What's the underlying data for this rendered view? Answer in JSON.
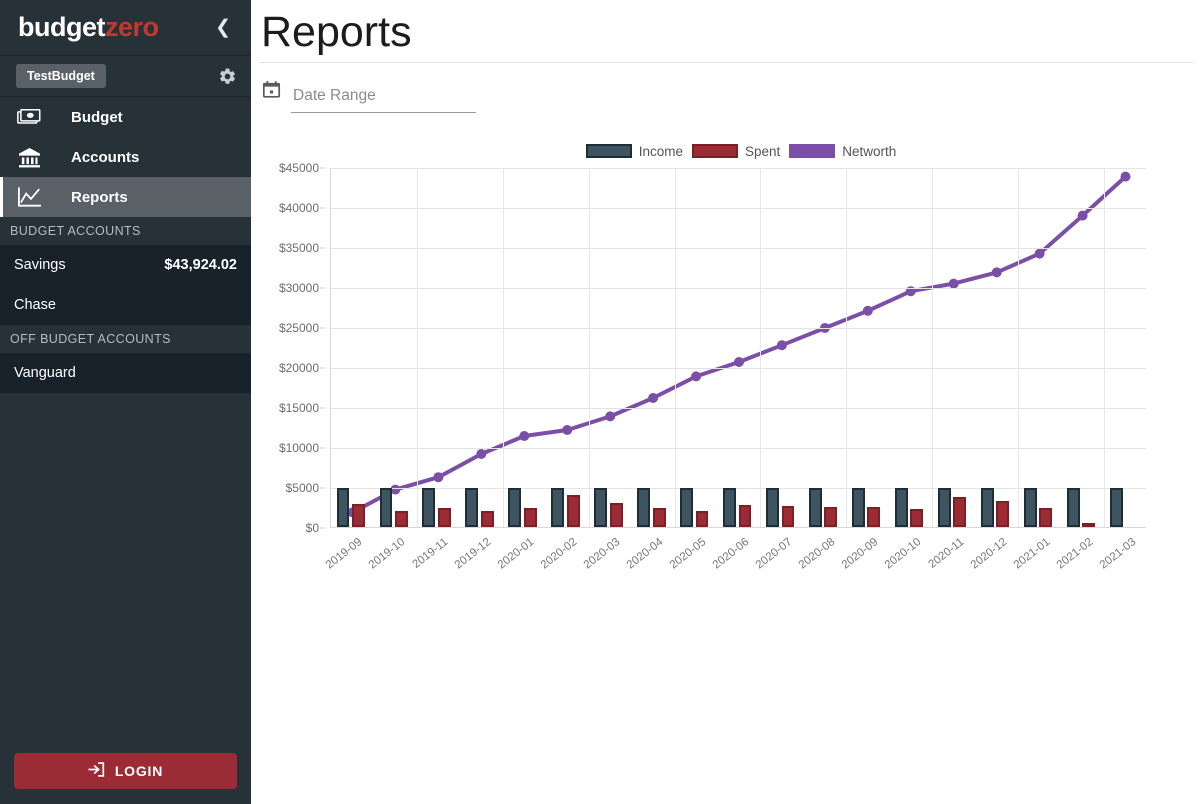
{
  "sidebar": {
    "brand": {
      "part1": "budget",
      "part2": "zero"
    },
    "collapse_icon": "chevron-left-icon",
    "budget_chip": "TestBudget",
    "settings_icon": "gear-icon",
    "nav": [
      {
        "label": "Budget",
        "icon": "money-icon",
        "active": false
      },
      {
        "label": "Accounts",
        "icon": "bank-icon",
        "active": false
      },
      {
        "label": "Reports",
        "icon": "chart-line-icon",
        "active": true
      }
    ],
    "budget_accounts_header": "BUDGET ACCOUNTS",
    "budget_accounts": [
      {
        "name": "Savings",
        "balance": "$43,924.02"
      },
      {
        "name": "Chase",
        "balance": ""
      }
    ],
    "off_budget_accounts_header": "OFF BUDGET ACCOUNTS",
    "off_budget_accounts": [
      {
        "name": "Vanguard",
        "balance": ""
      }
    ],
    "login_label": "LOGIN",
    "login_icon": "login-arrow-icon",
    "login_color": "#9b2c35"
  },
  "main": {
    "page_title": "Reports",
    "date_range": {
      "icon": "calendar-icon",
      "placeholder": "Date Range",
      "value": ""
    }
  },
  "chart_data": {
    "type": "bar",
    "title": "",
    "xlabel": "",
    "ylabel": "",
    "ylim": [
      0,
      45000
    ],
    "yticks": [
      0,
      5000,
      10000,
      15000,
      20000,
      25000,
      30000,
      35000,
      40000,
      45000
    ],
    "ytick_labels": [
      "$0",
      "$5000",
      "$10000",
      "$15000",
      "$20000",
      "$25000",
      "$30000",
      "$35000",
      "$40000",
      "$45000"
    ],
    "grid": true,
    "legend_position": "top-center",
    "categories": [
      "2019-09",
      "2019-10",
      "2019-11",
      "2019-12",
      "2020-01",
      "2020-02",
      "2020-03",
      "2020-04",
      "2020-05",
      "2020-06",
      "2020-07",
      "2020-08",
      "2020-09",
      "2020-10",
      "2020-11",
      "2020-12",
      "2021-01",
      "2021-02",
      "2021-03"
    ],
    "series": [
      {
        "name": "Income",
        "type": "bar",
        "color": "#3f5461",
        "border_color": "#1e2e36",
        "values": [
          4920,
          4920,
          4920,
          4920,
          4920,
          4920,
          4920,
          4920,
          4920,
          4920,
          4920,
          4920,
          4920,
          4920,
          4920,
          4920,
          4920,
          4870,
          4920
        ]
      },
      {
        "name": "Spent",
        "type": "bar",
        "color": "#9b2c35",
        "border_color": "#7e1f27",
        "values": [
          2900,
          1950,
          2350,
          2000,
          2350,
          3950,
          3050,
          2350,
          2000,
          2750,
          2650,
          2500,
          2450,
          2250,
          3800,
          3200,
          2350,
          60,
          0
        ]
      },
      {
        "name": "Networth",
        "type": "line",
        "color": "#7b4fa8",
        "values": [
          1950,
          4800,
          6350,
          9250,
          11500,
          12250,
          13950,
          16250,
          18950,
          20750,
          22850,
          25000,
          27150,
          29600,
          30550,
          31950,
          34300,
          39050,
          43924
        ]
      }
    ]
  }
}
